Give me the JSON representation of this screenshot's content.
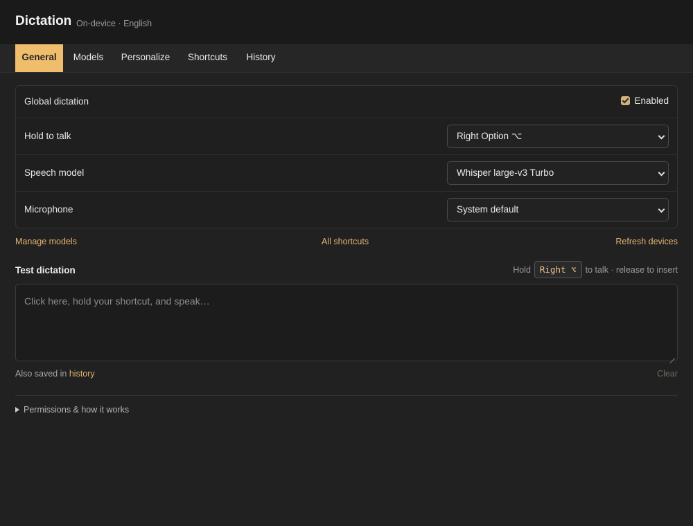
{
  "header": {
    "title": "Dictation",
    "subtitle": "On-device · English"
  },
  "tabs": [
    {
      "label": "General",
      "active": true
    },
    {
      "label": "Models",
      "active": false
    },
    {
      "label": "Personalize",
      "active": false
    },
    {
      "label": "Shortcuts",
      "active": false
    },
    {
      "label": "History",
      "active": false
    }
  ],
  "settings": {
    "global_dictation": {
      "label": "Global dictation",
      "checkbox_label": "Enabled",
      "checked": true
    },
    "hold_to_talk": {
      "label": "Hold to talk",
      "value": "Right Option ⌥"
    },
    "speech_model": {
      "label": "Speech model",
      "value": "Whisper large-v3 Turbo"
    },
    "microphone": {
      "label": "Microphone",
      "value": "System default"
    }
  },
  "links": {
    "manage_models": "Manage models",
    "all_shortcuts": "All shortcuts",
    "refresh_devices": "Refresh devices"
  },
  "test": {
    "title": "Test dictation",
    "hint_prefix": "Hold",
    "hint_key": "Right ⌥",
    "hint_suffix": "to talk · release to insert",
    "placeholder": "Click here, hold your shortcut, and speak…",
    "saved_prefix": "Also saved in",
    "saved_link": "history",
    "clear_label": "Clear"
  },
  "footer": {
    "disclosure_label": "Permissions & how it works"
  },
  "colors": {
    "accent": "#f0bd6c",
    "link": "#e2b270",
    "background": "#212121"
  },
  "icons": {
    "checkbox": "checkmark-icon",
    "select": "chevron-down-icon",
    "disclosure": "triangle-right-icon"
  }
}
